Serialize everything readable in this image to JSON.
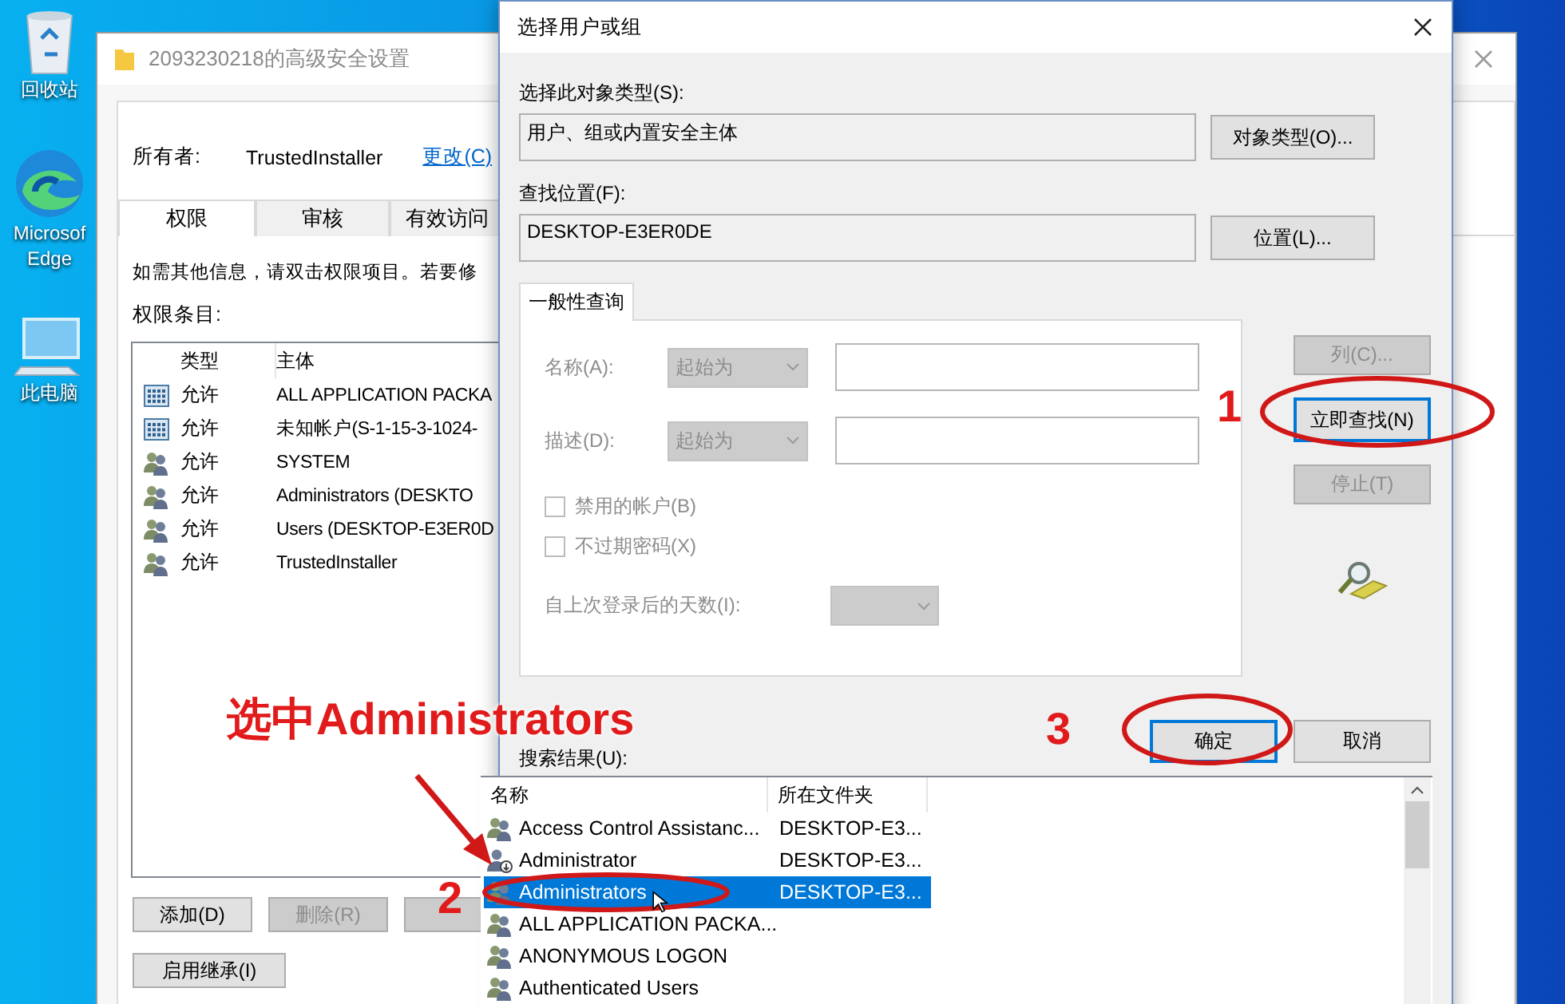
{
  "desktop_icons": [
    {
      "kind": "recycle_bin",
      "lines": [
        "回收站"
      ]
    },
    {
      "kind": "browser",
      "lines": [
        "Microsof",
        "Edge"
      ]
    },
    {
      "kind": "computer",
      "lines": [
        "此电脑"
      ]
    }
  ],
  "background_window": {
    "title": "2093230218的高级安全设置",
    "owner_label": "所有者:",
    "owner": "TrustedInstaller",
    "change_link": "更改(C)",
    "tabs": [
      {
        "label": "权限",
        "selected": true
      },
      {
        "label": "审核",
        "selected": false
      },
      {
        "label": "有效访问",
        "selected": false
      }
    ],
    "info": "如需其他信息，请双击权限项目。若要修",
    "entries_label": "权限条目:",
    "columns": [
      "类型",
      "主体"
    ],
    "rows": [
      {
        "kind": "app",
        "type": "允许",
        "principal": "ALL APPLICATION PACKA"
      },
      {
        "kind": "app",
        "type": "允许",
        "principal": "未知帐户(S-1-15-3-1024-"
      },
      {
        "kind": "group",
        "type": "允许",
        "principal": "SYSTEM"
      },
      {
        "kind": "group",
        "type": "允许",
        "principal": "Administrators (DESKTO"
      },
      {
        "kind": "group",
        "type": "允许",
        "principal": "Users (DESKTOP-E3ER0D"
      },
      {
        "kind": "group",
        "type": "允许",
        "principal": "TrustedInstaller"
      }
    ],
    "buttons": [
      {
        "label": "添加(D)",
        "disabled": false
      },
      {
        "label": "删除(R)",
        "disabled": true
      },
      {
        "disabled": true
      }
    ],
    "inherit_button": "启用继承(I)"
  },
  "dialog": {
    "title": "选择用户或组",
    "type_label": "选择此对象类型(S):",
    "type_value": "用户、组或内置安全主体",
    "type_button": "对象类型(O)...",
    "location_label": "查找位置(F):",
    "location_value": "DESKTOP-E3ER0DE",
    "location_button": "位置(L)...",
    "query_tab": "一般性查询",
    "fields": [
      {
        "label": "名称(A):",
        "combo": "起始为",
        "disabled": true
      },
      {
        "label": "描述(D):",
        "combo": "起始为",
        "disabled": true
      }
    ],
    "checkboxes": [
      {
        "label": "禁用的帐户(B)",
        "checked": false
      },
      {
        "label": "不过期密码(X)",
        "checked": false
      }
    ],
    "days_label": "自上次登录后的天数(I):",
    "side_buttons": [
      {
        "label": "列(C)...",
        "disabled": true,
        "focused": false
      },
      {
        "label": "立即查找(N)",
        "disabled": false,
        "focused": true
      },
      {
        "label": "停止(T)",
        "disabled": true,
        "focused": false
      }
    ],
    "ok_buttons": [
      {
        "label": "确定",
        "focused": true
      },
      {
        "label": "取消",
        "focused": false
      }
    ],
    "results_label": "搜索结果(U):",
    "result_columns": [
      "名称",
      "所在文件夹"
    ],
    "results": [
      {
        "kind": "group",
        "name": "Access Control Assistanc...",
        "folder": "DESKTOP-E3...",
        "selected": false
      },
      {
        "kind": "user",
        "name": "Administrator",
        "folder": "DESKTOP-E3...",
        "selected": false
      },
      {
        "kind": "group",
        "name": "Administrators",
        "folder": "DESKTOP-E3...",
        "selected": true
      },
      {
        "kind": "group",
        "name": "ALL APPLICATION PACKA...",
        "selected": false
      },
      {
        "kind": "group",
        "name": "ANONYMOUS LOGON",
        "selected": false
      },
      {
        "kind": "group",
        "name": "Authenticated Users",
        "selected": false
      }
    ]
  },
  "annotations": {
    "caption": "选中Administrators",
    "steps": [
      "1",
      "2",
      "3"
    ]
  }
}
